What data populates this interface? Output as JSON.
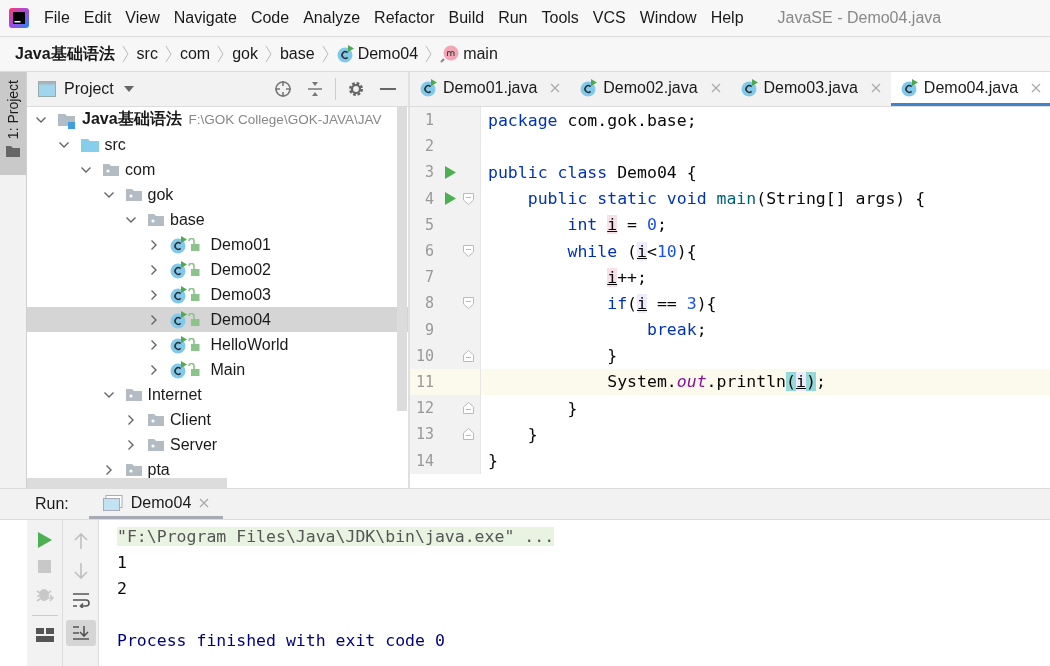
{
  "menu": {
    "items": [
      "File",
      "Edit",
      "View",
      "Navigate",
      "Code",
      "Analyze",
      "Refactor",
      "Build",
      "Run",
      "Tools",
      "VCS",
      "Window",
      "Help"
    ],
    "title": "JavaSE - Demo04.java"
  },
  "breadcrumbs": [
    {
      "label": "Java基础语法",
      "kind": "module"
    },
    {
      "label": "src",
      "kind": "folder"
    },
    {
      "label": "com",
      "kind": "folder"
    },
    {
      "label": "gok",
      "kind": "folder"
    },
    {
      "label": "base",
      "kind": "folder"
    },
    {
      "label": "Demo04",
      "kind": "class"
    },
    {
      "label": "main",
      "kind": "method"
    }
  ],
  "tool_strip": {
    "label": "1: Project",
    "selected": true
  },
  "project": {
    "title": "Project",
    "tree": [
      {
        "label": "Java基础语法",
        "path": "F:\\GOK College\\GOK-JAVA\\JAV",
        "kind": "module",
        "expanded": true,
        "selected": false,
        "children": [
          {
            "label": "src",
            "kind": "source",
            "expanded": true,
            "selected": false,
            "children": [
              {
                "label": "com",
                "kind": "package",
                "expanded": true,
                "selected": false,
                "children": [
                  {
                    "label": "gok",
                    "kind": "package",
                    "expanded": true,
                    "selected": false,
                    "children": [
                      {
                        "label": "base",
                        "kind": "package",
                        "expanded": true,
                        "selected": false,
                        "children": [
                          {
                            "label": "Demo01",
                            "kind": "class",
                            "expanded": false,
                            "selected": false
                          },
                          {
                            "label": "Demo02",
                            "kind": "class",
                            "expanded": false,
                            "selected": false
                          },
                          {
                            "label": "Demo03",
                            "kind": "class",
                            "expanded": false,
                            "selected": false
                          },
                          {
                            "label": "Demo04",
                            "kind": "class",
                            "expanded": false,
                            "selected": true
                          },
                          {
                            "label": "HelloWorld",
                            "kind": "class",
                            "expanded": false,
                            "selected": false
                          },
                          {
                            "label": "Main",
                            "kind": "class",
                            "expanded": false,
                            "selected": false
                          }
                        ]
                      }
                    ]
                  },
                  {
                    "label": "Internet",
                    "kind": "package",
                    "expanded": true,
                    "selected": false,
                    "children": [
                      {
                        "label": "Client",
                        "kind": "package",
                        "expanded": false,
                        "selected": false
                      },
                      {
                        "label": "Server",
                        "kind": "package",
                        "expanded": false,
                        "selected": false
                      }
                    ]
                  },
                  {
                    "label": "pta",
                    "kind": "package",
                    "expanded": false,
                    "selected": false
                  }
                ]
              }
            ]
          }
        ]
      }
    ]
  },
  "editor": {
    "tabs": [
      {
        "label": "Demo01.java",
        "selected": false
      },
      {
        "label": "Demo02.java",
        "selected": false
      },
      {
        "label": "Demo03.java",
        "selected": false
      },
      {
        "label": "Demo04.java",
        "selected": true
      }
    ],
    "lines": [
      {
        "number": "1",
        "current": false,
        "tokens": [
          {
            "text": "package",
            "kind": "keyword"
          },
          {
            "text": " com.gok.base;",
            "kind": "plain"
          }
        ]
      },
      {
        "number": "2",
        "current": false
      },
      {
        "number": "3",
        "run": true,
        "current": false,
        "tokens": [
          {
            "text": "public class ",
            "kind": "keyword"
          },
          {
            "text": "Demo04 {",
            "kind": "plain"
          }
        ]
      },
      {
        "number": "4",
        "run": true,
        "fold_start": true,
        "current": false,
        "tokens": [
          {
            "text": "    public static void ",
            "kind": "keyword"
          },
          {
            "text": "main",
            "kind": "method"
          },
          {
            "text": "(String[] args) {",
            "kind": "plain"
          }
        ]
      },
      {
        "number": "5",
        "current": false,
        "tokens": [
          {
            "text": "        int ",
            "kind": "keyword"
          },
          {
            "text": "i",
            "kind": "var-write"
          },
          {
            "text": " = ",
            "kind": "plain"
          },
          {
            "text": "0",
            "kind": "number"
          },
          {
            "text": ";",
            "kind": "plain"
          }
        ]
      },
      {
        "number": "6",
        "fold_start": true,
        "current": false,
        "tokens": [
          {
            "text": "        while ",
            "kind": "keyword"
          },
          {
            "text": "(",
            "kind": "plain"
          },
          {
            "text": "i",
            "kind": "var-read"
          },
          {
            "text": "<",
            "kind": "plain"
          },
          {
            "text": "10",
            "kind": "number"
          },
          {
            "text": "){",
            "kind": "plain"
          }
        ]
      },
      {
        "number": "7",
        "current": false,
        "tokens": [
          {
            "text": "            i",
            "kind": "var-write"
          },
          {
            "text": "++;",
            "kind": "plain"
          }
        ]
      },
      {
        "number": "8",
        "fold_start": true,
        "current": false,
        "tokens": [
          {
            "text": "            if",
            "kind": "keyword"
          },
          {
            "text": "(",
            "kind": "plain"
          },
          {
            "text": "i",
            "kind": "var-read"
          },
          {
            "text": " == ",
            "kind": "plain"
          },
          {
            "text": "3",
            "kind": "number"
          },
          {
            "text": "){",
            "kind": "plain"
          }
        ]
      },
      {
        "number": "9",
        "current": false,
        "tokens": [
          {
            "text": "                break",
            "kind": "keyword"
          },
          {
            "text": ";",
            "kind": "plain"
          }
        ]
      },
      {
        "number": "10",
        "fold_end": true,
        "current": false,
        "tokens": [
          {
            "text": "            }",
            "kind": "plain"
          }
        ]
      },
      {
        "number": "11",
        "current": true,
        "tokens": [
          {
            "text": "            System.",
            "kind": "plain"
          },
          {
            "text": "out",
            "kind": "field"
          },
          {
            "text": ".println",
            "kind": "plain"
          },
          {
            "text": "(",
            "kind": "brace-match"
          },
          {
            "text": "i",
            "kind": "var-read"
          },
          {
            "text": ")",
            "kind": "brace-match"
          },
          {
            "text": ";",
            "kind": "plain"
          }
        ]
      },
      {
        "number": "12",
        "fold_end": true,
        "current": false,
        "tokens": [
          {
            "text": "        }",
            "kind": "plain"
          }
        ]
      },
      {
        "number": "13",
        "fold_end": true,
        "current": false,
        "tokens": [
          {
            "text": "    }",
            "kind": "plain"
          }
        ]
      },
      {
        "number": "14",
        "current": false,
        "tokens": [
          {
            "text": "}",
            "kind": "plain"
          }
        ]
      }
    ]
  },
  "run": {
    "label": "Run:",
    "tab": {
      "label": "Demo04",
      "selected": true
    },
    "console": [
      {
        "kind": "command",
        "text": "\"F:\\Program Files\\Java\\JDK\\bin\\java.exe\" ..."
      },
      {
        "kind": "output",
        "text": "1"
      },
      {
        "kind": "output",
        "text": "2"
      },
      {
        "kind": "blank"
      },
      {
        "kind": "exit",
        "text": "Process finished with exit code 0"
      }
    ]
  }
}
